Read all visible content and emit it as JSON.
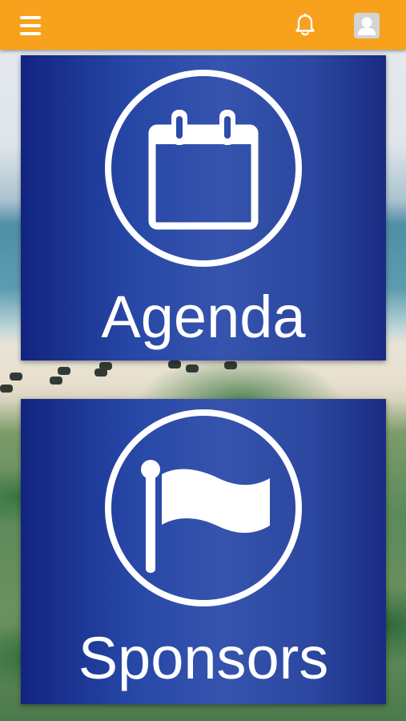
{
  "header": {
    "background_color": "#f7a11d",
    "menu_icon": "hamburger-menu-icon",
    "notification_icon": "bell-icon",
    "profile_icon": "user-avatar-icon"
  },
  "tiles": [
    {
      "label": "Agenda",
      "icon": "calendar-icon"
    },
    {
      "label": "Sponsors",
      "icon": "flag-icon"
    }
  ],
  "colors": {
    "tile_blue": "#2747a6",
    "icon_white": "#ffffff"
  }
}
